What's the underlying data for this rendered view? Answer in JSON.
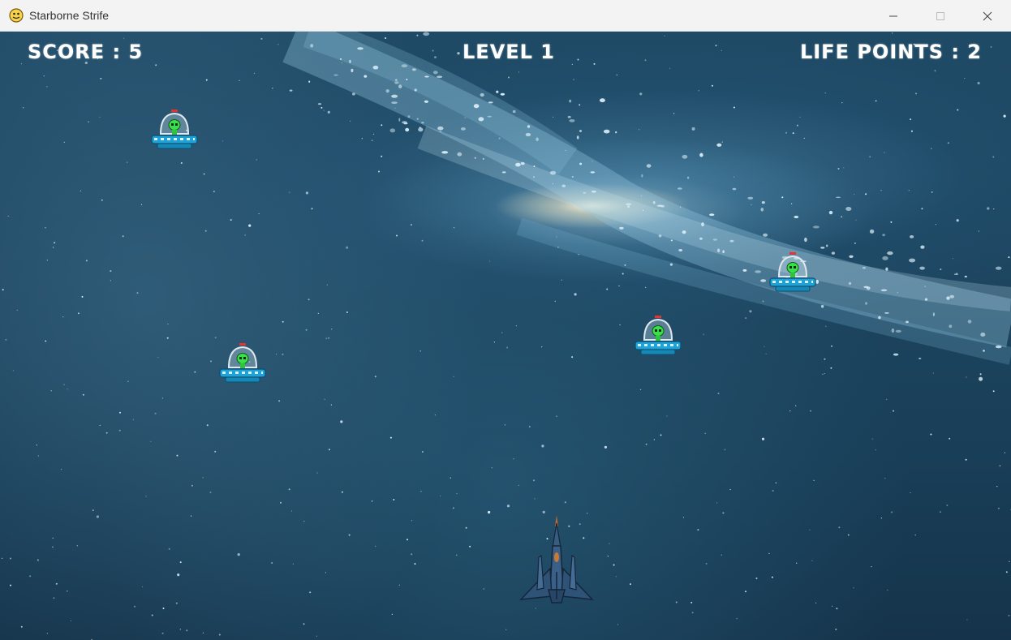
{
  "window": {
    "title": "Starborne Strife",
    "app_icon": "python-snake-icon",
    "controls": [
      "minimize-icon",
      "maximize-icon",
      "close-icon"
    ]
  },
  "hud": {
    "score_text": "SCORE : 5",
    "level_text": "LEVEL 1",
    "lives_text": "LIFE POINTS : 2"
  },
  "sprites": {
    "enemy": "alien-ufo",
    "player": "player-spaceship"
  },
  "colors": {
    "hud_text": "#ffffff",
    "alien": "#38e04a",
    "ufo_body": "#1fa3d6",
    "ship": "#34567a"
  }
}
